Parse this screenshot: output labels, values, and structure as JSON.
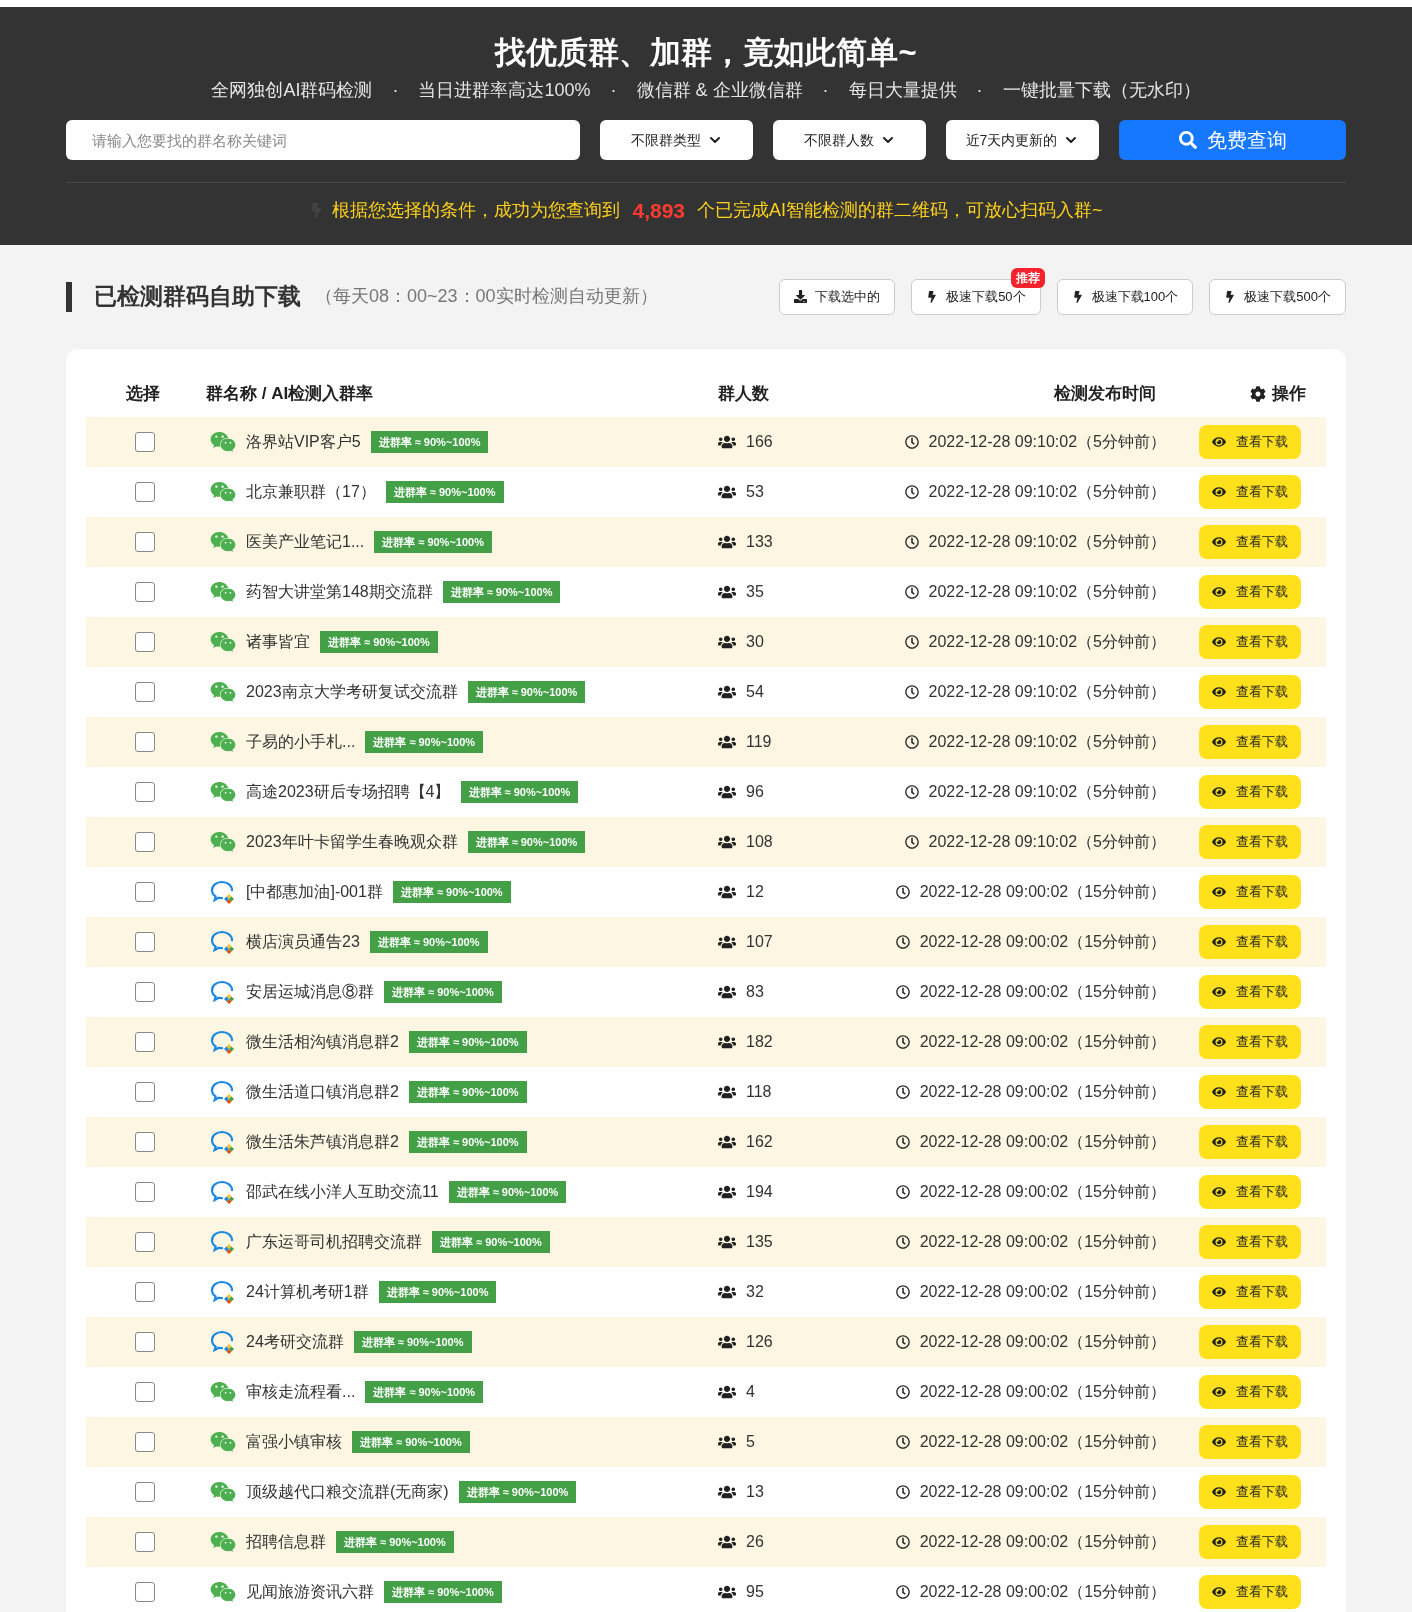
{
  "header": {
    "title": "找优质群、加群，竟如此简单~",
    "features": [
      "全网独创AI群码检测",
      "当日进群率高达100%",
      "微信群 & 企业微信群",
      "每日大量提供",
      "一键批量下载（无水印）"
    ],
    "separator": "·",
    "search": {
      "placeholder": "请输入您要找的群名称关键词"
    },
    "filters": [
      "不限群类型",
      "不限群人数",
      "近7天内更新的"
    ],
    "search_button": "免费查询",
    "result": {
      "before": "根据您选择的条件，成功为您查询到",
      "count": "4,893",
      "after": "个已完成AI智能检测的群二维码，可放心扫码入群~"
    }
  },
  "section": {
    "title": "已检测群码自助下载",
    "note": "（每天08：00~23：00实时检测自动更新）",
    "actions": [
      {
        "label": "下载选中的",
        "kind": "download"
      },
      {
        "label": "极速下载50个",
        "kind": "fast",
        "badge": "推荐"
      },
      {
        "label": "极速下载100个",
        "kind": "fast"
      },
      {
        "label": "极速下载500个",
        "kind": "fast"
      }
    ]
  },
  "table": {
    "columns": [
      "选择",
      "群名称 / AI检测入群率",
      "群人数",
      "检测发布时间",
      "操作"
    ],
    "rows": [
      {
        "kind": "wechat",
        "checked": false,
        "name": "洛界站VIP客户5",
        "rate": "进群率 ≈ 90%~100%",
        "members": "166",
        "time": "2022-12-28 09:10:02（5分钟前）",
        "action": "查看下载"
      },
      {
        "kind": "wechat",
        "checked": false,
        "name": "北京兼职群（17）",
        "rate": "进群率 ≈ 90%~100%",
        "members": "53",
        "time": "2022-12-28 09:10:02（5分钟前）",
        "action": "查看下载"
      },
      {
        "kind": "wechat",
        "checked": false,
        "name": "医美产业笔记1...",
        "rate": "进群率 ≈ 90%~100%",
        "members": "133",
        "time": "2022-12-28 09:10:02（5分钟前）",
        "action": "查看下载"
      },
      {
        "kind": "wechat",
        "checked": false,
        "name": "药智大讲堂第148期交流群",
        "rate": "进群率 ≈ 90%~100%",
        "members": "35",
        "time": "2022-12-28 09:10:02（5分钟前）",
        "action": "查看下载"
      },
      {
        "kind": "wechat",
        "checked": false,
        "name": "诸事皆宜",
        "rate": "进群率 ≈ 90%~100%",
        "members": "30",
        "time": "2022-12-28 09:10:02（5分钟前）",
        "action": "查看下载"
      },
      {
        "kind": "wechat",
        "checked": false,
        "name": "2023南京大学考研复试交流群",
        "rate": "进群率 ≈ 90%~100%",
        "members": "54",
        "time": "2022-12-28 09:10:02（5分钟前）",
        "action": "查看下载"
      },
      {
        "kind": "wechat",
        "checked": false,
        "name": "子易的小手札...",
        "rate": "进群率 ≈ 90%~100%",
        "members": "119",
        "time": "2022-12-28 09:10:02（5分钟前）",
        "action": "查看下载"
      },
      {
        "kind": "wechat",
        "checked": false,
        "name": "高途2023研后专场招聘【4】",
        "rate": "进群率 ≈ 90%~100%",
        "members": "96",
        "time": "2022-12-28 09:10:02（5分钟前）",
        "action": "查看下载"
      },
      {
        "kind": "wechat",
        "checked": false,
        "name": "2023年叶卡留学生春晚观众群",
        "rate": "进群率 ≈ 90%~100%",
        "members": "108",
        "time": "2022-12-28 09:10:02（5分钟前）",
        "action": "查看下载"
      },
      {
        "kind": "work",
        "checked": false,
        "name": "[中都惠加油]-001群",
        "rate": "进群率 ≈ 90%~100%",
        "members": "12",
        "time": "2022-12-28 09:00:02（15分钟前）",
        "action": "查看下载"
      },
      {
        "kind": "work",
        "checked": false,
        "name": "横店演员通告23",
        "rate": "进群率 ≈ 90%~100%",
        "members": "107",
        "time": "2022-12-28 09:00:02（15分钟前）",
        "action": "查看下载"
      },
      {
        "kind": "work",
        "checked": false,
        "name": "安居运城消息⑧群",
        "rate": "进群率 ≈ 90%~100%",
        "members": "83",
        "time": "2022-12-28 09:00:02（15分钟前）",
        "action": "查看下载"
      },
      {
        "kind": "work",
        "checked": false,
        "name": "微生活相沟镇消息群2",
        "rate": "进群率 ≈ 90%~100%",
        "members": "182",
        "time": "2022-12-28 09:00:02（15分钟前）",
        "action": "查看下载"
      },
      {
        "kind": "work",
        "checked": false,
        "name": "微生活道口镇消息群2",
        "rate": "进群率 ≈ 90%~100%",
        "members": "118",
        "time": "2022-12-28 09:00:02（15分钟前）",
        "action": "查看下载"
      },
      {
        "kind": "work",
        "checked": false,
        "name": "微生活朱芦镇消息群2",
        "rate": "进群率 ≈ 90%~100%",
        "members": "162",
        "time": "2022-12-28 09:00:02（15分钟前）",
        "action": "查看下载"
      },
      {
        "kind": "work",
        "checked": false,
        "name": "邵武在线小洋人互助交流11",
        "rate": "进群率 ≈ 90%~100%",
        "members": "194",
        "time": "2022-12-28 09:00:02（15分钟前）",
        "action": "查看下载"
      },
      {
        "kind": "work",
        "checked": false,
        "name": "广东运哥司机招聘交流群",
        "rate": "进群率 ≈ 90%~100%",
        "members": "135",
        "time": "2022-12-28 09:00:02（15分钟前）",
        "action": "查看下载"
      },
      {
        "kind": "work",
        "checked": false,
        "name": "24计算机考研1群",
        "rate": "进群率 ≈ 90%~100%",
        "members": "32",
        "time": "2022-12-28 09:00:02（15分钟前）",
        "action": "查看下载"
      },
      {
        "kind": "work",
        "checked": false,
        "name": "24考研交流群",
        "rate": "进群率 ≈ 90%~100%",
        "members": "126",
        "time": "2022-12-28 09:00:02（15分钟前）",
        "action": "查看下载"
      },
      {
        "kind": "wechat",
        "checked": false,
        "name": "审核走流程看...",
        "rate": "进群率 ≈ 90%~100%",
        "members": "4",
        "time": "2022-12-28 09:00:02（15分钟前）",
        "action": "查看下载"
      },
      {
        "kind": "wechat",
        "checked": false,
        "name": "富强小镇审核",
        "rate": "进群率 ≈ 90%~100%",
        "members": "5",
        "time": "2022-12-28 09:00:02（15分钟前）",
        "action": "查看下载"
      },
      {
        "kind": "wechat",
        "checked": false,
        "name": "顶级越代口粮交流群(无商家)",
        "rate": "进群率 ≈ 90%~100%",
        "members": "13",
        "time": "2022-12-28 09:00:02（15分钟前）",
        "action": "查看下载"
      },
      {
        "kind": "wechat",
        "checked": false,
        "name": "招聘信息群",
        "rate": "进群率 ≈ 90%~100%",
        "members": "26",
        "time": "2022-12-28 09:00:02（15分钟前）",
        "action": "查看下载"
      },
      {
        "kind": "wechat",
        "checked": false,
        "name": "见闻旅游资讯六群",
        "rate": "进群率 ≈ 90%~100%",
        "members": "95",
        "time": "2022-12-28 09:00:02（15分钟前）",
        "action": "查看下载"
      }
    ]
  }
}
